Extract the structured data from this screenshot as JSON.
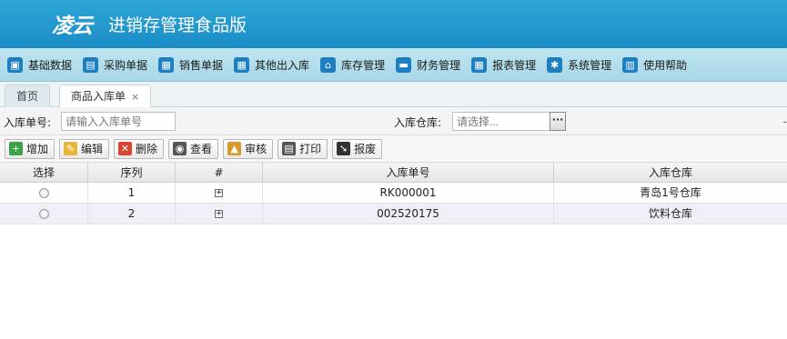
{
  "header": {
    "logo": "凌云",
    "title": "进销存管理食品版"
  },
  "menu": [
    {
      "label": "基础数据",
      "icon": "cube-icon",
      "glyph": "▣"
    },
    {
      "label": "采购单据",
      "icon": "basket-icon",
      "glyph": "▤"
    },
    {
      "label": "销售单据",
      "icon": "calculator-icon",
      "glyph": "▦"
    },
    {
      "label": "其他出入库",
      "icon": "calculator-icon",
      "glyph": "▦"
    },
    {
      "label": "库存管理",
      "icon": "home-icon",
      "glyph": "⌂"
    },
    {
      "label": "财务管理",
      "icon": "money-icon",
      "glyph": "▬"
    },
    {
      "label": "报表管理",
      "icon": "calculator-icon",
      "glyph": "▦"
    },
    {
      "label": "系统管理",
      "icon": "gear-icon",
      "glyph": "✱"
    },
    {
      "label": "使用帮助",
      "icon": "book-icon",
      "glyph": "▥"
    }
  ],
  "tabs": [
    {
      "label": "首页"
    },
    {
      "label": "商品入库单",
      "close": "×"
    }
  ],
  "search": {
    "order_label": "入库单号:",
    "order_placeholder": "请输入入库单号",
    "warehouse_label": "入库仓库:",
    "warehouse_placeholder": "请选择...",
    "dots": "···",
    "edge": "-"
  },
  "toolbar": [
    {
      "label": "增加",
      "icon": "plus-icon",
      "glyph": "+",
      "color": "#3aa345"
    },
    {
      "label": "编辑",
      "icon": "edit-icon",
      "glyph": "✎",
      "color": "#e8b43a"
    },
    {
      "label": "删除",
      "icon": "delete-icon",
      "glyph": "✕",
      "color": "#d8442f"
    },
    {
      "label": "查看",
      "icon": "binoculars-icon",
      "glyph": "◉",
      "color": "#555555"
    },
    {
      "label": "审核",
      "icon": "lock-icon",
      "glyph": "▲",
      "color": "#d99a2a"
    },
    {
      "label": "打印",
      "icon": "printer-icon",
      "glyph": "▤",
      "color": "#555555"
    },
    {
      "label": "报废",
      "icon": "arrow-icon",
      "glyph": "➘",
      "color": "#333333"
    }
  ],
  "grid": {
    "columns": [
      "选择",
      "序列",
      "#",
      "入库单号",
      "入库仓库"
    ],
    "rows": [
      {
        "seq": "1",
        "expand": "+",
        "order_no": "RK000001",
        "warehouse": "青岛1号仓库"
      },
      {
        "seq": "2",
        "expand": "+",
        "order_no": "002520175",
        "warehouse": "饮料仓库"
      }
    ]
  }
}
